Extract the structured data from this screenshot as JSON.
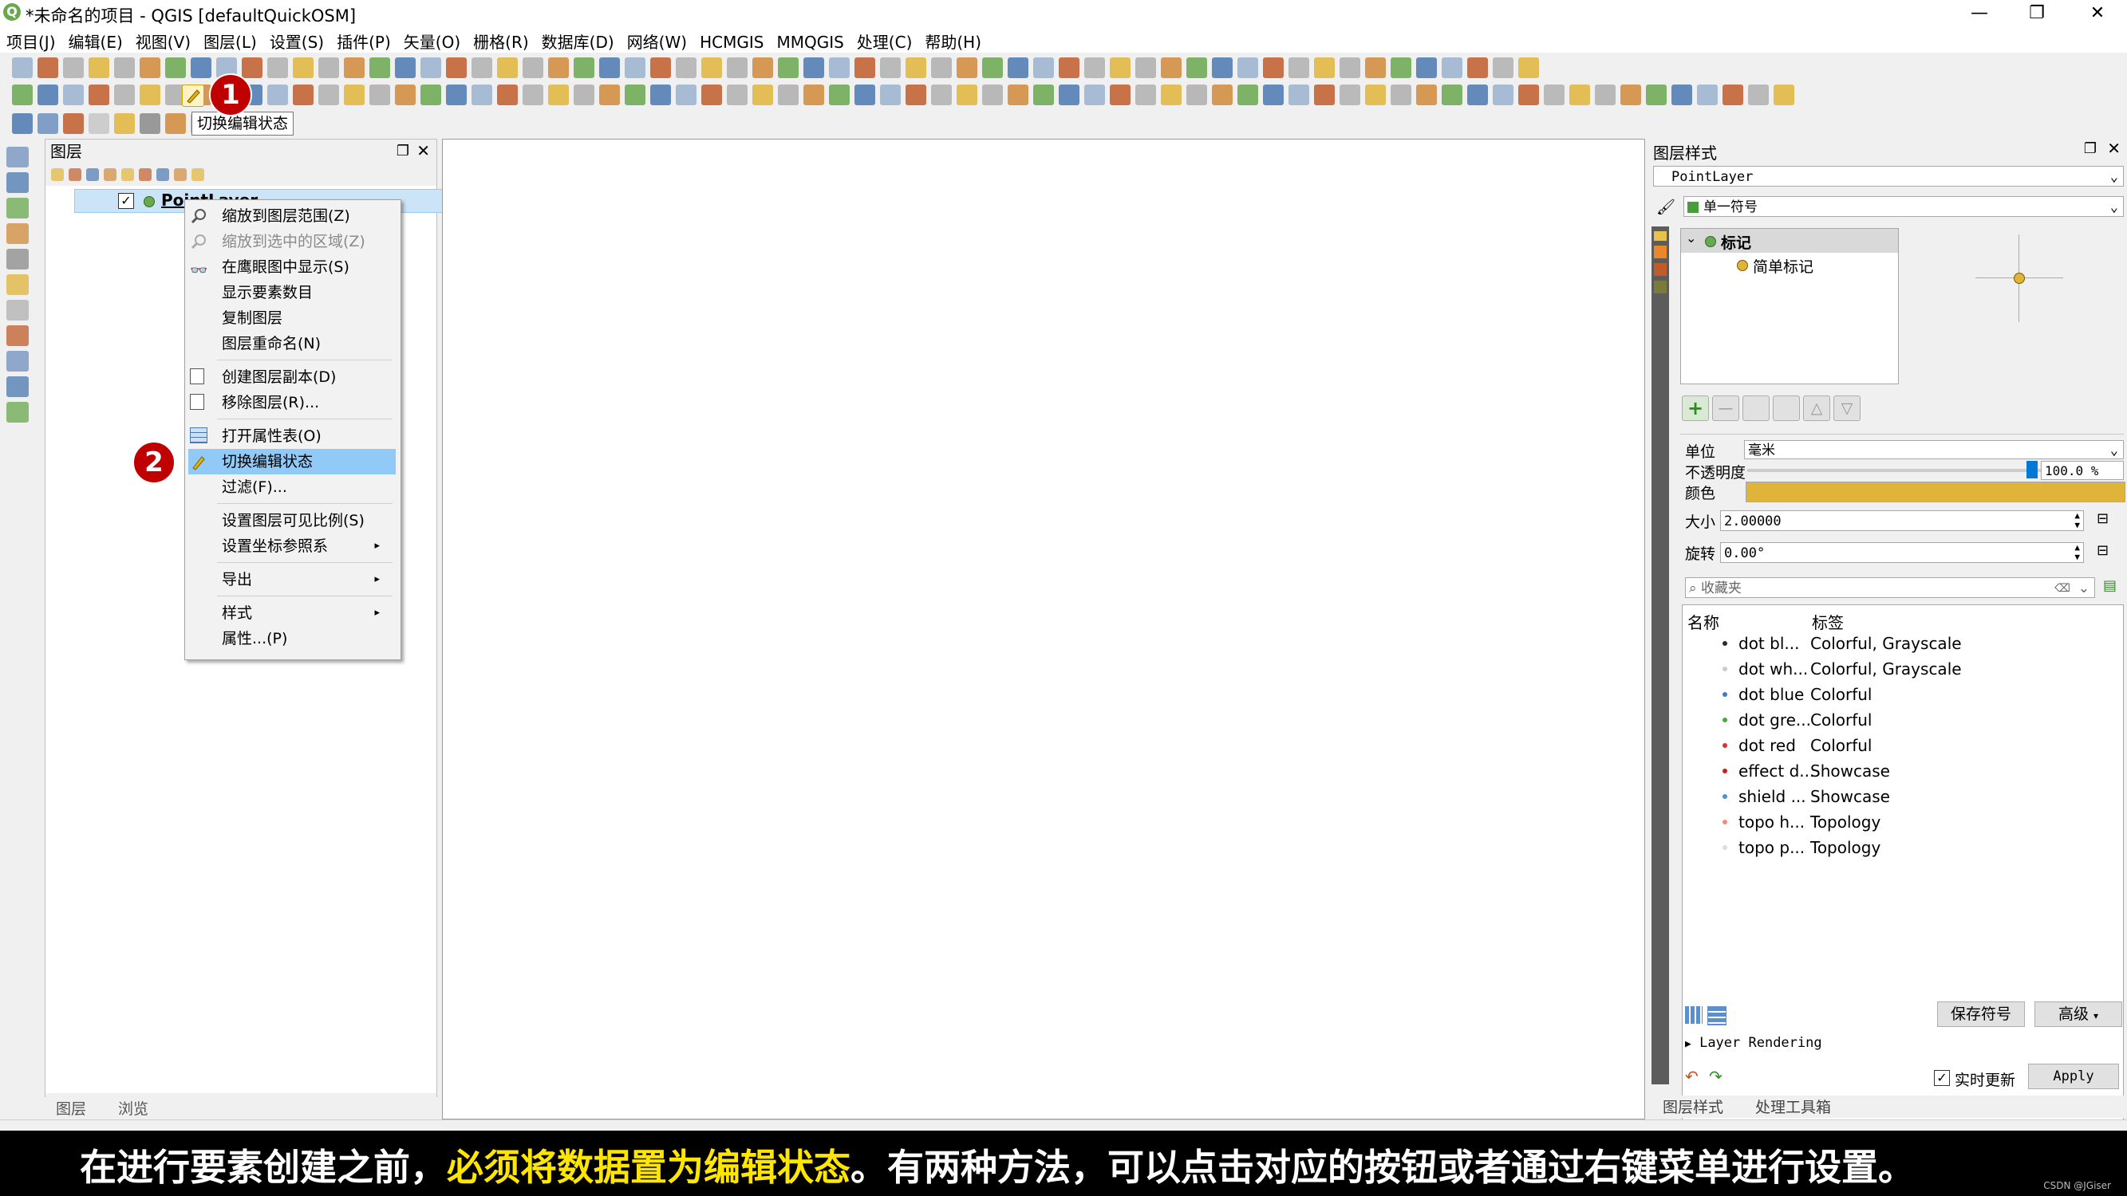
{
  "window": {
    "title": "*未命名的项目 - QGIS [defaultQuickOSM]",
    "minimize": "—",
    "restore": "❐",
    "close": "✕"
  },
  "menubar": [
    "项目(J)",
    "编辑(E)",
    "视图(V)",
    "图层(L)",
    "设置(S)",
    "插件(P)",
    "矢量(O)",
    "栅格(R)",
    "数据库(D)",
    "网络(W)",
    "HCMGIS",
    "MMQGIS",
    "处理(C)",
    "帮助(H)"
  ],
  "tooltip": "切换编辑状态",
  "callouts": {
    "one": "1",
    "two": "2"
  },
  "layers_panel": {
    "title": "图层",
    "layer_name": "PointLayer",
    "tabs": [
      "图层",
      "浏览"
    ]
  },
  "context_menu": {
    "items": [
      {
        "label": "缩放到图层范围(Z)",
        "enabled": true
      },
      {
        "label": "缩放到选中的区域(Z)",
        "enabled": false
      },
      {
        "label": "在鹰眼图中显示(S)",
        "enabled": true
      },
      {
        "label": "显示要素数目",
        "enabled": true
      },
      {
        "label": "复制图层",
        "enabled": true
      },
      {
        "label": "图层重命名(N)",
        "enabled": true
      },
      {
        "label": "创建图层副本(D)",
        "enabled": true
      },
      {
        "label": "移除图层(R)...",
        "enabled": true
      },
      {
        "label": "打开属性表(O)",
        "enabled": true
      },
      {
        "label": "切换编辑状态",
        "enabled": true,
        "selected": true
      },
      {
        "label": "过滤(F)...",
        "enabled": true
      },
      {
        "label": "设置图层可见比例(S)",
        "enabled": true
      },
      {
        "label": "设置坐标参照系",
        "enabled": true,
        "submenu": true
      },
      {
        "label": "导出",
        "enabled": true,
        "submenu": true
      },
      {
        "label": "样式",
        "enabled": true,
        "submenu": true
      },
      {
        "label": "属性...(P)",
        "enabled": true
      }
    ]
  },
  "style_panel": {
    "title": "图层样式",
    "layer_select": "PointLayer",
    "renderer": "单一符号",
    "tree_root": "标记",
    "tree_child": "简单标记",
    "unit_label": "单位",
    "unit_value": "毫米",
    "opacity_label": "不透明度",
    "opacity_value": "100.0 %",
    "color_label": "颜色",
    "color_hex": "#e0b43a",
    "size_label": "大小",
    "size_value": "2.00000",
    "rotation_label": "旋转",
    "rotation_value": "0.00°",
    "favorites_placeholder": "收藏夹",
    "col_name": "名称",
    "col_tag": "标签",
    "symbols": [
      {
        "name": "dot  bl...",
        "tag": "Colorful, Grayscale",
        "color": "#2b2b2b"
      },
      {
        "name": "dot  wh...",
        "tag": "Colorful, Grayscale",
        "color": "#cccccc"
      },
      {
        "name": "dot blue",
        "tag": "Colorful",
        "color": "#3c7dc4"
      },
      {
        "name": "dot gre...",
        "tag": "Colorful",
        "color": "#49a63e"
      },
      {
        "name": "dot red",
        "tag": "Colorful",
        "color": "#d63030"
      },
      {
        "name": "effect d...",
        "tag": "Showcase",
        "color": "#c62020"
      },
      {
        "name": "shield ...",
        "tag": "Showcase",
        "color": "#4f8fd0"
      },
      {
        "name": "topo h...",
        "tag": "Topology",
        "color": "#f08a7a"
      },
      {
        "name": "topo p...",
        "tag": "Topology",
        "color": "#dddddd"
      }
    ],
    "save_symbol": "保存符号",
    "advanced": "高级",
    "layer_rendering": "Layer Rendering",
    "live_update": "实时更新",
    "apply": "Apply",
    "bottom_tabs": [
      "图层样式",
      "处理工具箱"
    ]
  },
  "subtitle": {
    "part1": "在进行要素创建之前，",
    "highlight": "必须将数据置为编辑状态",
    "part2": "。有两种方法，可以点击对应的按钮或者通过右键菜单进行设置。"
  },
  "credit": "CSDN @JGiser"
}
